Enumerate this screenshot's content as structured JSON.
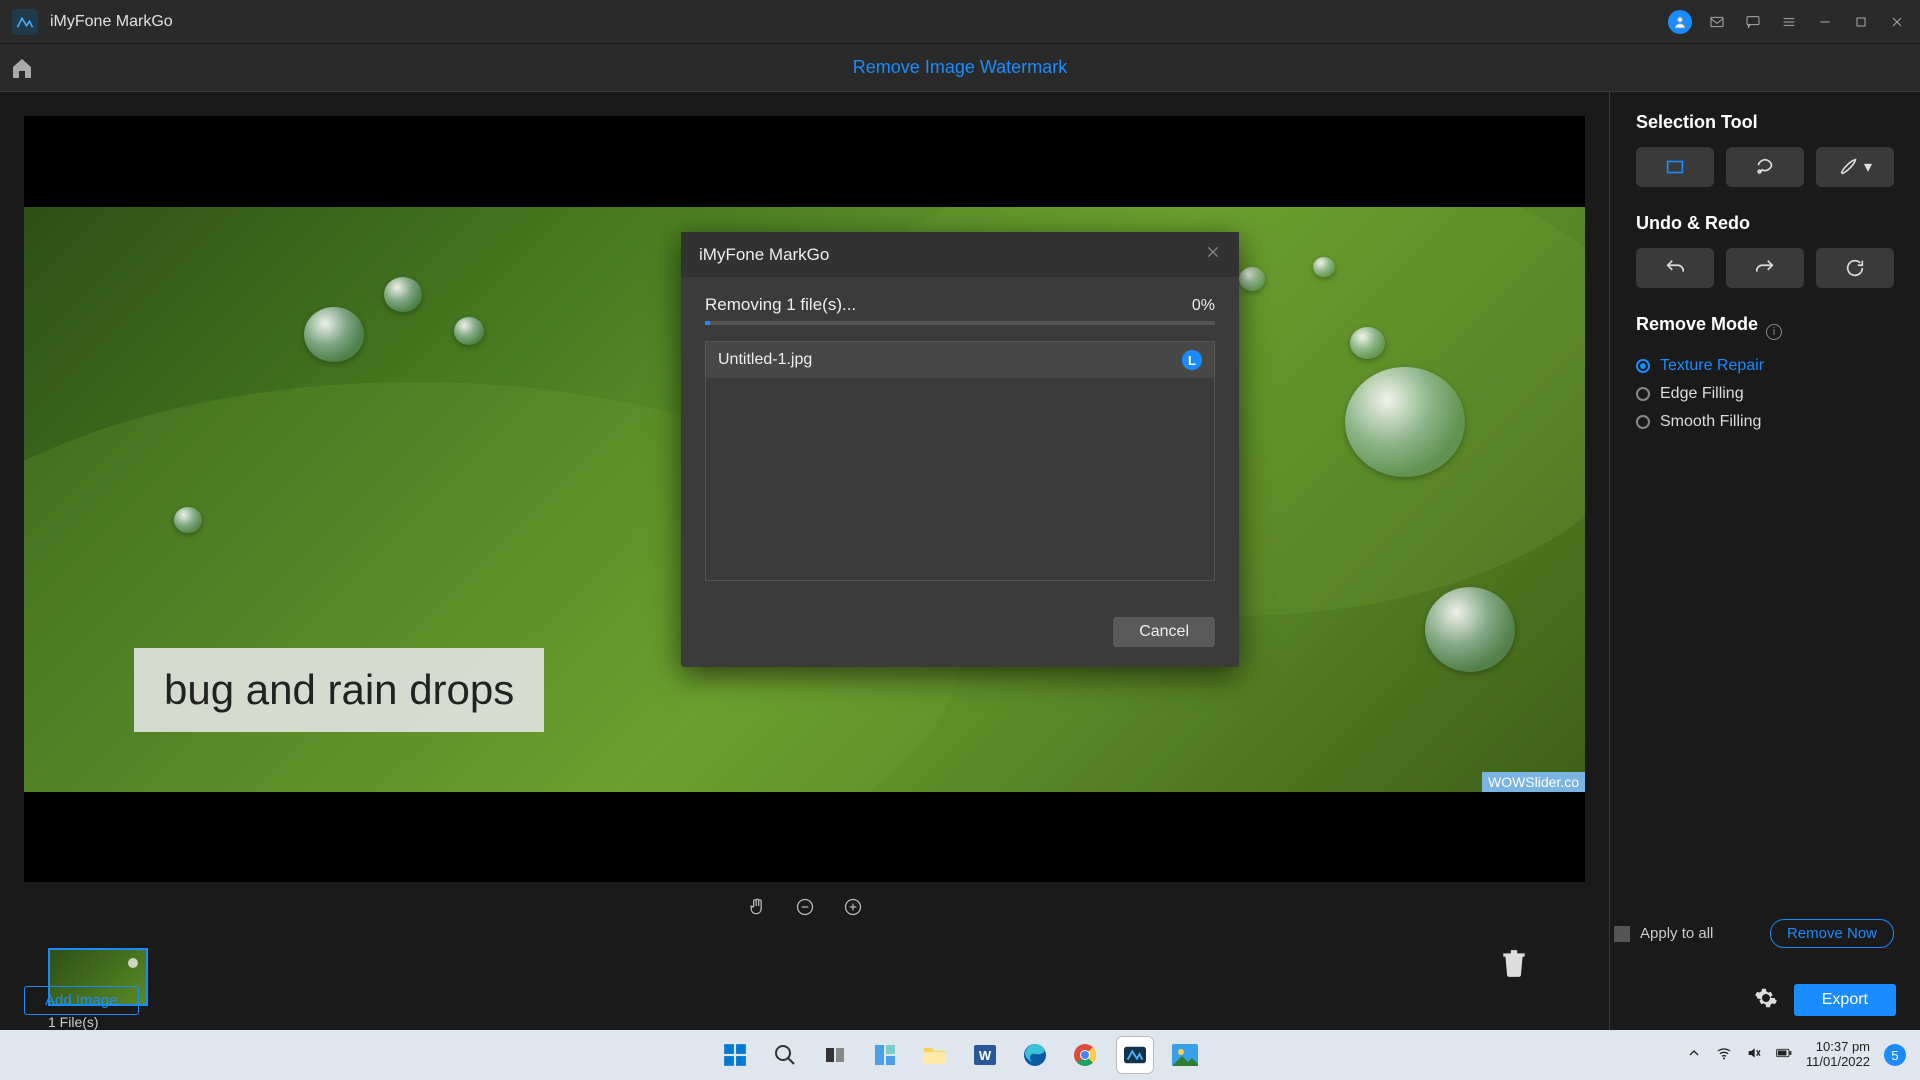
{
  "app": {
    "title": "iMyFone MarkGo"
  },
  "header": {
    "tab_title": "Remove Image Watermark"
  },
  "canvas": {
    "caption": "bug and rain drops",
    "wowslider": "WOWSlider.co"
  },
  "tools": {
    "selection_title": "Selection Tool",
    "undo_title": "Undo & Redo",
    "mode_title": "Remove Mode",
    "modes": [
      "Texture Repair",
      "Edge Filling",
      "Smooth Filling"
    ],
    "apply_all": "Apply to all",
    "remove_now": "Remove Now"
  },
  "thumbs": {
    "count": "1 File(s)",
    "add_image": "Add Image",
    "export": "Export"
  },
  "modal": {
    "title": "iMyFone MarkGo",
    "status": "Removing 1 file(s)...",
    "percent": "0%",
    "file": "Untitled-1.jpg",
    "cancel": "Cancel"
  },
  "taskbar": {
    "time": "10:37 pm",
    "date": "11/01/2022",
    "badge": "5"
  }
}
